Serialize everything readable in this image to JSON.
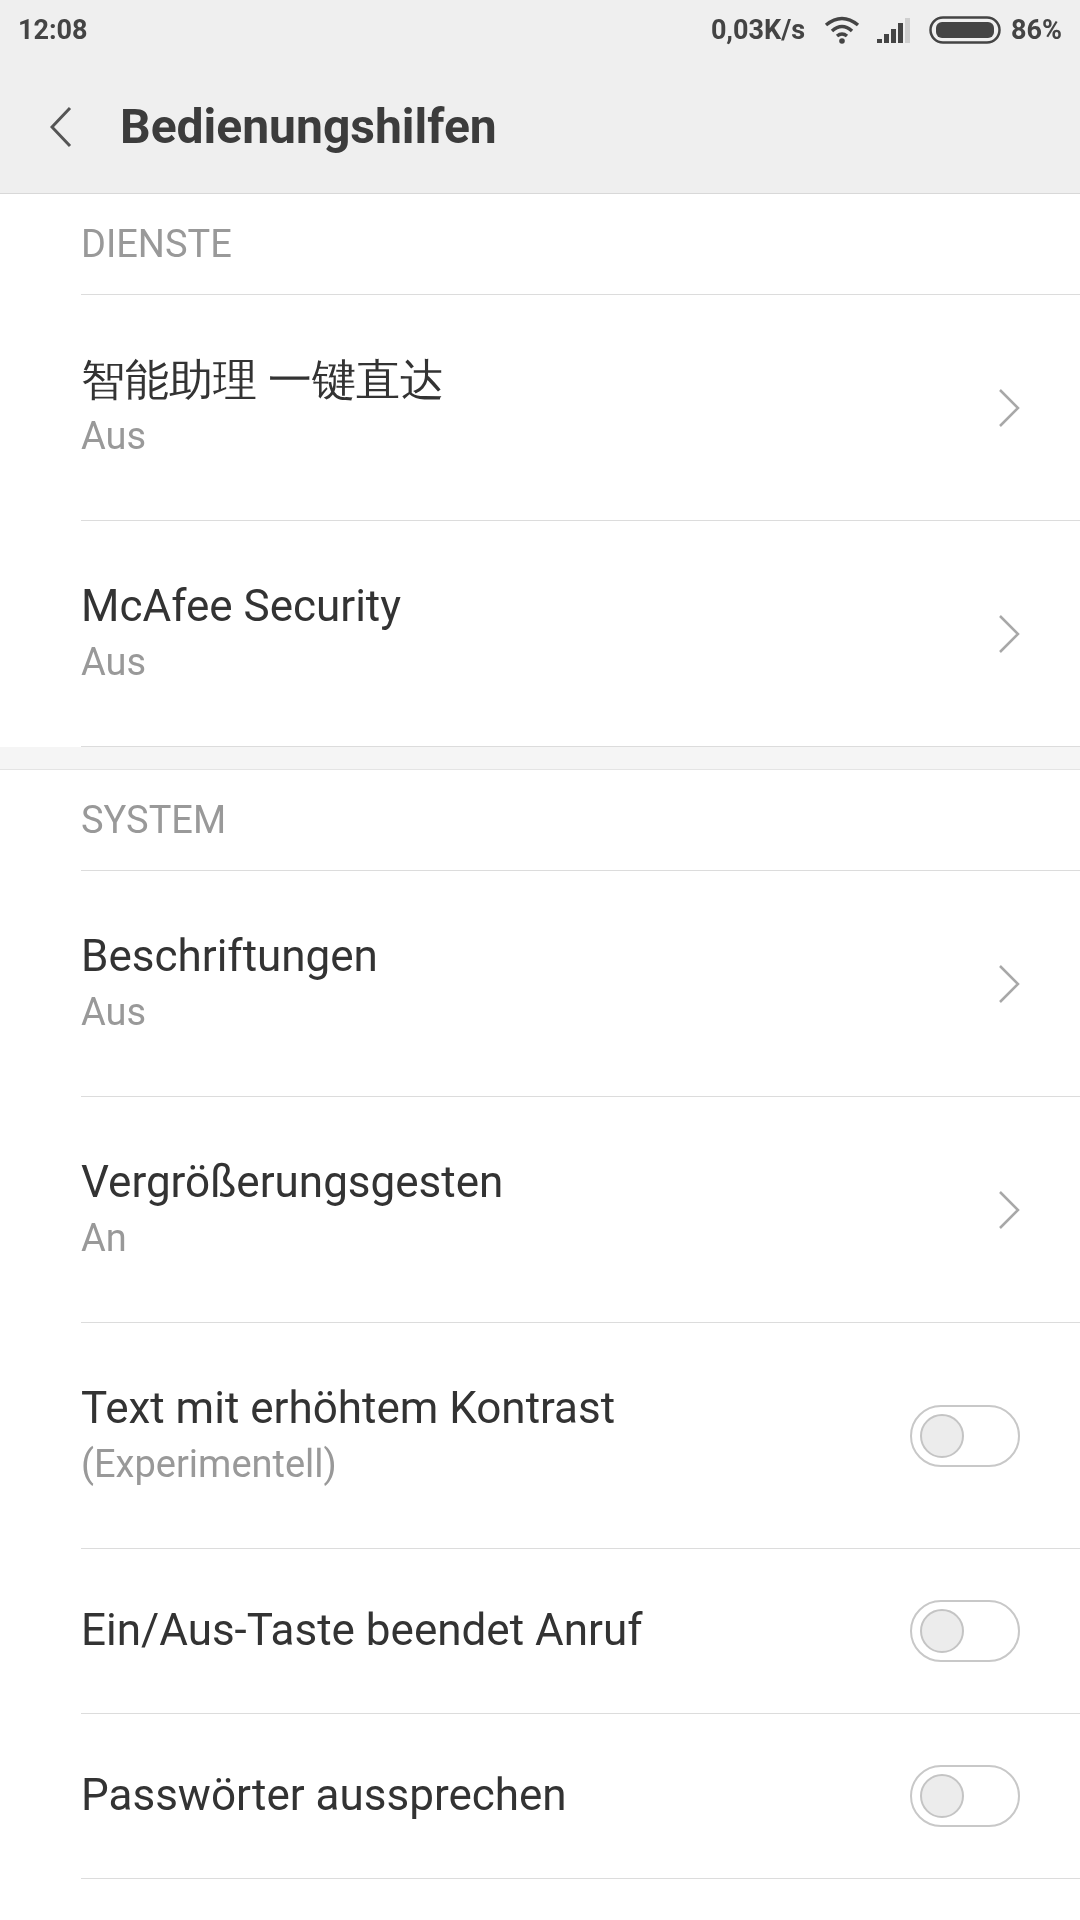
{
  "status_bar": {
    "time": "12:08",
    "speed": "0,03K/s",
    "battery": "86%"
  },
  "header": {
    "title": "Bedienungshilfen"
  },
  "sections": [
    {
      "title": "DIENSTE",
      "items": [
        {
          "kind": "link",
          "label": "智能助理 一键直达",
          "summary": "Aus"
        },
        {
          "kind": "link",
          "label": "McAfee Security",
          "summary": "Aus"
        }
      ]
    },
    {
      "title": "SYSTEM",
      "items": [
        {
          "kind": "link",
          "label": "Beschriftungen",
          "summary": "Aus"
        },
        {
          "kind": "link",
          "label": "Vergrößerungsgesten",
          "summary": "An"
        },
        {
          "kind": "switch",
          "label": "Text mit erhöhtem Kontrast",
          "summary": "(Experimentell)",
          "on": false
        },
        {
          "kind": "switch",
          "label": "Ein/Aus-Taste beendet Anruf",
          "on": false
        },
        {
          "kind": "switch",
          "label": "Passwörter aussprechen",
          "on": false
        }
      ]
    }
  ]
}
